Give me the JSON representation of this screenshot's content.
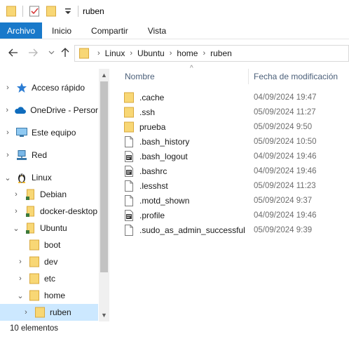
{
  "window": {
    "title": "ruben"
  },
  "ribbon": {
    "tabs": [
      "Archivo",
      "Inicio",
      "Compartir",
      "Vista"
    ]
  },
  "address": {
    "crumbs": [
      "Linux",
      "Ubuntu",
      "home",
      "ruben"
    ]
  },
  "nav_tree": [
    {
      "label": "Acceso rápido",
      "icon": "star-icon"
    },
    {
      "label": "OneDrive - Persor",
      "icon": "cloud-icon"
    },
    {
      "label": "Este equipo",
      "icon": "computer-icon"
    },
    {
      "label": "Red",
      "icon": "network-icon"
    },
    {
      "label": "Linux",
      "icon": "penguin-icon"
    },
    {
      "label": "Debian",
      "icon": "folder-icon"
    },
    {
      "label": "docker-desktop",
      "icon": "folder-icon"
    },
    {
      "label": "Ubuntu",
      "icon": "folder-icon"
    },
    {
      "label": "boot",
      "icon": "folder-icon"
    },
    {
      "label": "dev",
      "icon": "folder-icon"
    },
    {
      "label": "etc",
      "icon": "folder-icon"
    },
    {
      "label": "home",
      "icon": "folder-icon"
    },
    {
      "label": "ruben",
      "icon": "folder-icon"
    }
  ],
  "columns": {
    "name": "Nombre",
    "modified": "Fecha de modificación"
  },
  "files": [
    {
      "name": ".cache",
      "date": "04/09/2024 19:47",
      "icon": "folder-icon"
    },
    {
      "name": ".ssh",
      "date": "05/09/2024 11:27",
      "icon": "folder-icon"
    },
    {
      "name": "prueba",
      "date": "05/09/2024 9:50",
      "icon": "folder-icon"
    },
    {
      "name": ".bash_history",
      "date": "05/09/2024 10:50",
      "icon": "file-icon"
    },
    {
      "name": ".bash_logout",
      "date": "04/09/2024 19:46",
      "icon": "script-file-icon"
    },
    {
      "name": ".bashrc",
      "date": "04/09/2024 19:46",
      "icon": "script-file-icon"
    },
    {
      "name": ".lesshst",
      "date": "05/09/2024 11:23",
      "icon": "file-icon"
    },
    {
      "name": ".motd_shown",
      "date": "05/09/2024 9:37",
      "icon": "file-icon"
    },
    {
      "name": ".profile",
      "date": "04/09/2024 19:46",
      "icon": "script-file-icon"
    },
    {
      "name": ".sudo_as_admin_successful",
      "date": "05/09/2024 9:39",
      "icon": "file-icon"
    }
  ],
  "status": {
    "item_count": "10 elementos"
  },
  "colors": {
    "accent": "#1979ca",
    "selection": "#cce8ff",
    "folder": "#f8d775",
    "header_text": "#4c607a"
  }
}
